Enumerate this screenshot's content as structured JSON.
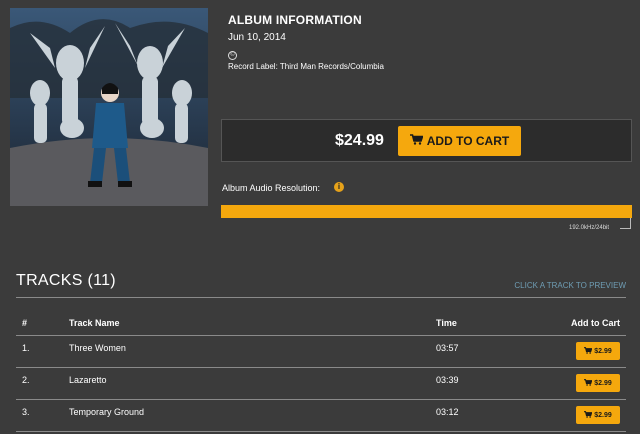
{
  "album": {
    "info_title": "ALBUM INFORMATION",
    "release_date": "Jun 10, 2014",
    "copyright_symbol": "©",
    "record_label": "Record Label: Third Man Records/Columbia"
  },
  "purchase": {
    "price": "$24.99",
    "add_to_cart_label": "ADD TO CART",
    "button_color": "#f5a80d"
  },
  "resolution": {
    "label": "Album Audio Resolution:",
    "info_icon": "i",
    "value_text": "192.0kHz/24bit",
    "bar_fill_fraction": 1.0
  },
  "tracks": {
    "title": "TRACKS (11)",
    "preview_hint": "CLICK A TRACK TO PREVIEW",
    "headers": {
      "num": "#",
      "name": "Track Name",
      "time": "Time",
      "cart": "Add to Cart"
    },
    "rows": [
      {
        "num": "1.",
        "name": "Three Women",
        "time": "03:57",
        "price": "$2.99"
      },
      {
        "num": "2.",
        "name": "Lazaretto",
        "time": "03:39",
        "price": "$2.99"
      },
      {
        "num": "3.",
        "name": "Temporary Ground",
        "time": "03:12",
        "price": "$2.99"
      }
    ]
  },
  "icons": {
    "cart": "cart-icon",
    "info": "info-icon",
    "copyright": "copyright-icon"
  }
}
